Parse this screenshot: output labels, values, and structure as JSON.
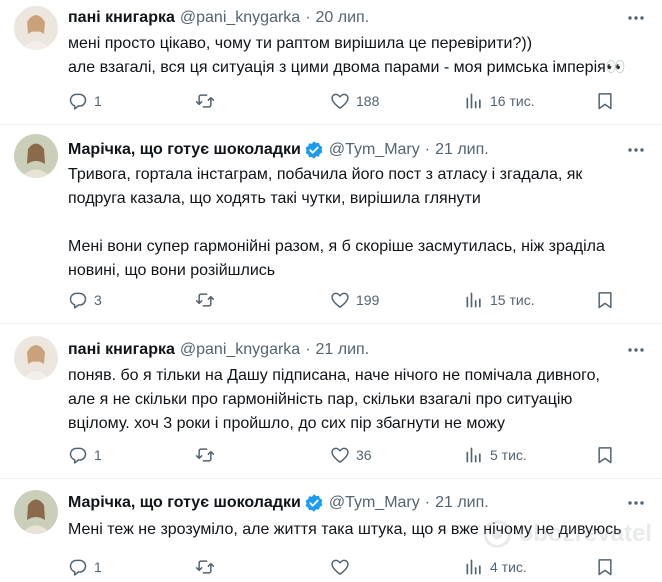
{
  "tweets": [
    {
      "name": "пані книгарка",
      "handle": "@pani_knygarka",
      "date": "20 лип.",
      "verified": false,
      "lines": [
        "мені просто цікаво, чому ти раптом вирішила це перевірити?))",
        "але взагалі, вся ця ситуація з цими двома парами - моя римська імперія👀"
      ],
      "replies": "1",
      "reposts": "",
      "likes": "188",
      "views": "16 тис."
    },
    {
      "name": "Марічка, що готує шоколадки",
      "handle": "@Tym_Mary",
      "date": "21 лип.",
      "verified": true,
      "lines": [
        "Тривога, гортала інстаграм, побачила його пост з атласу і згадала, як",
        "подруга казала, що ходять такі чутки, вирішила глянути",
        "",
        "Мені вони супер гармонійні разом, я б скоріше засмутилась, ніж зраділа",
        "новині, що вони розійшлись"
      ],
      "replies": "3",
      "reposts": "",
      "likes": "199",
      "views": "15 тис."
    },
    {
      "name": "пані книгарка",
      "handle": "@pani_knygarka",
      "date": "21 лип.",
      "verified": false,
      "lines": [
        "поняв. бо я тільки на Дашу підписана, наче нічого не помічала дивного,",
        "але я не скільки про гармонійність пар, скільки взагалі про ситуацію",
        "вцілому. хоч 3 роки і пройшло, до сих пір збагнути не можу"
      ],
      "replies": "1",
      "reposts": "",
      "likes": "36",
      "views": "5 тис."
    },
    {
      "name": "Марічка, що готує шоколадки",
      "handle": "@Tym_Mary",
      "date": "21 лип.",
      "verified": true,
      "lines": [
        "Мені теж не зрозуміло, але життя така штука, що я вже нічому не дивуюсь"
      ],
      "replies": "1",
      "reposts": "",
      "likes": "",
      "views": "4 тис."
    }
  ],
  "colors": {
    "text": "#0f1419",
    "secondary": "#536471",
    "divider": "#eff3f4",
    "verified": "#1d9bf0"
  },
  "icons": [
    "more-icon",
    "reply-icon",
    "repost-icon",
    "like-icon",
    "views-icon",
    "bookmark-icon",
    "verified-icon"
  ],
  "watermark": "obozrevatel"
}
